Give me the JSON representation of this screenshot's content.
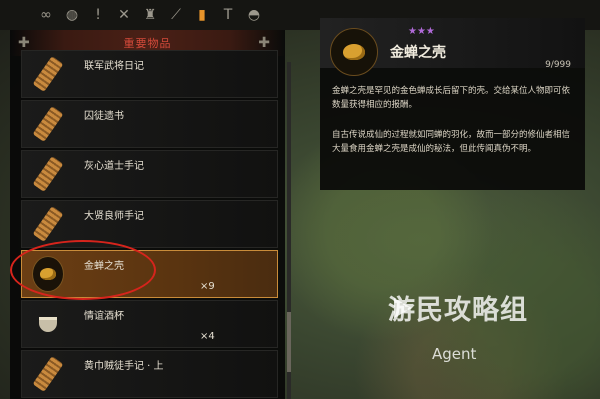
{
  "tabs": [
    {
      "icon": "infinity-icon",
      "glyph": "∞"
    },
    {
      "icon": "shield-icon",
      "glyph": "◍"
    },
    {
      "icon": "alert-icon",
      "glyph": "!"
    },
    {
      "icon": "crossed-swords-icon",
      "glyph": "✕"
    },
    {
      "icon": "armor-icon",
      "glyph": "♜"
    },
    {
      "icon": "staff-icon",
      "glyph": "⟋"
    },
    {
      "icon": "torch-icon",
      "glyph": "▮"
    },
    {
      "icon": "hammer-icon",
      "glyph": "T"
    },
    {
      "icon": "pouch-icon",
      "glyph": "◓"
    }
  ],
  "list": {
    "header": "重要物品",
    "items": [
      {
        "name": "联军武将日记",
        "icon": "scroll-icon",
        "count": "",
        "selected": false
      },
      {
        "name": "囚徒遗书",
        "icon": "scroll-icon",
        "count": "",
        "selected": false
      },
      {
        "name": "灰心道士手记",
        "icon": "scroll-icon",
        "count": "",
        "selected": false
      },
      {
        "name": "大贤良师手记",
        "icon": "scroll-icon",
        "count": "",
        "selected": false
      },
      {
        "name": "金蝉之壳",
        "icon": "cicada-shell-icon",
        "count": "×9",
        "selected": true
      },
      {
        "name": "情谊酒杯",
        "icon": "wine-cup-icon",
        "count": "×4",
        "selected": false
      },
      {
        "name": "黄巾贼徒手记 · 上",
        "icon": "scroll-icon",
        "count": "",
        "selected": false
      }
    ]
  },
  "detail": {
    "stars": "★★★",
    "name": "金蝉之壳",
    "quantity": "9/999",
    "desc1": "金蝉之壳是罕见的金色蝉成长后留下的壳。交给某位人物即可依数量获得相应的报酬。",
    "desc2": "自古传说成仙的过程就如同蝉的羽化，故而一部分的修仙者相信大量食用金蝉之壳是成仙的秘法，但此传闻真伪不明。"
  },
  "watermark": {
    "title": "游民攻略组",
    "subtitle": "Agent"
  },
  "colors": {
    "accent": "#e8942a",
    "selected_bg": "#6b3e14",
    "header_red": "#d44a3a",
    "stars": "#b06ad8",
    "highlight_ring": "#d6241c"
  }
}
